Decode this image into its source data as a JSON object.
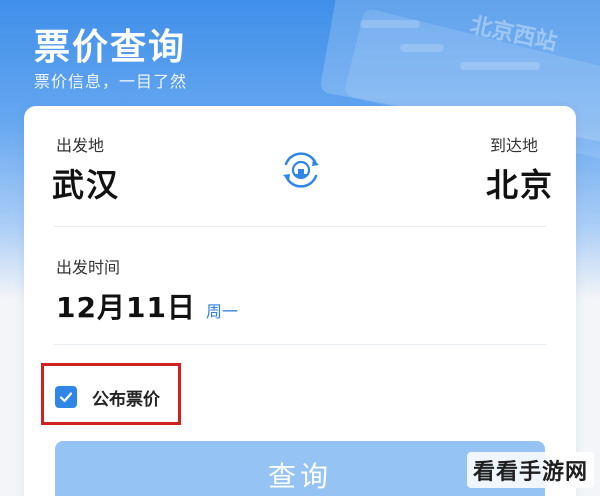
{
  "header": {
    "title": "票价查询",
    "subtitle": "票价信息，一目了然",
    "watermark_text": "北京西站"
  },
  "route": {
    "from_label": "出发地",
    "from_city": "武汉",
    "to_label": "到达地",
    "to_city": "北京",
    "swap_icon": "railway-logo-swap-icon"
  },
  "departure": {
    "label": "出发时间",
    "date": "12月11日",
    "weekday": "周一"
  },
  "options": {
    "public_fare_label": "公布票价",
    "public_fare_checked": true
  },
  "actions": {
    "query_label": "查询"
  },
  "site_watermark": "看看手游网",
  "colors": {
    "accent": "#2f86e6",
    "header_blue": "#3f8fe9",
    "button": "#94c3f4",
    "highlight": "#d02020"
  }
}
